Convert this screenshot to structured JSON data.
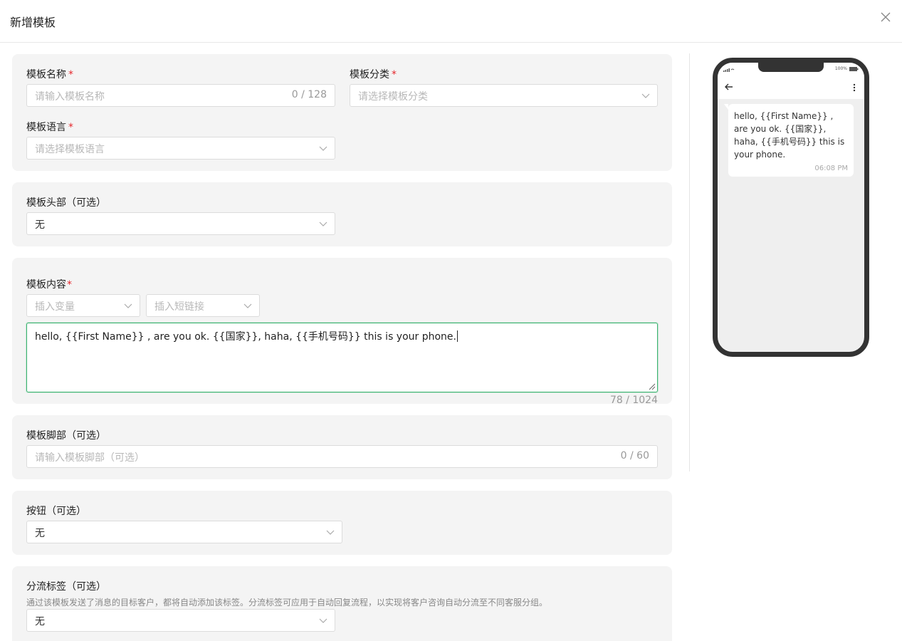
{
  "dialog": {
    "title": "新增模板"
  },
  "basic": {
    "name_label": "模板名称",
    "name_placeholder": "请输入模板名称",
    "name_count": "0 / 128",
    "category_label": "模板分类",
    "category_placeholder": "请选择模板分类",
    "language_label": "模板语言",
    "language_placeholder": "请选择模板语言",
    "required_mark": "*"
  },
  "header_section": {
    "label": "模板头部（可选）",
    "value": "无"
  },
  "content_section": {
    "label": "模板内容",
    "insert_variable_placeholder": "插入变量",
    "insert_link_placeholder": "插入短链接",
    "text": "hello, {{First Name}} , are you ok. {{国家}}, haha, {{手机号码}} this is your phone.",
    "count": "78 / 1024"
  },
  "footer_section": {
    "label": "模板脚部（可选）",
    "placeholder": "请输入模板脚部（可选）",
    "count": "0 / 60"
  },
  "buttons_section": {
    "label": "按钮（可选）",
    "value": "无"
  },
  "tag_section": {
    "label": "分流标签（可选）",
    "hint": "通过该模板发送了消息的目标客户，都将自动添加该标签。分流标签可应用于自动回复流程，以实现将客户咨询自动分流至不同客服分组。",
    "value": "无"
  },
  "preview": {
    "battery": "100%",
    "message": "hello, {{First Name}} , are you ok. {{国家}}, haha, {{手机号码}} this is your phone.",
    "time": "06:08 PM"
  },
  "colors": {
    "accent": "#3cb371",
    "required": "#e5282d",
    "card_bg": "#f4f4f4",
    "phone_frame": "#333333"
  }
}
